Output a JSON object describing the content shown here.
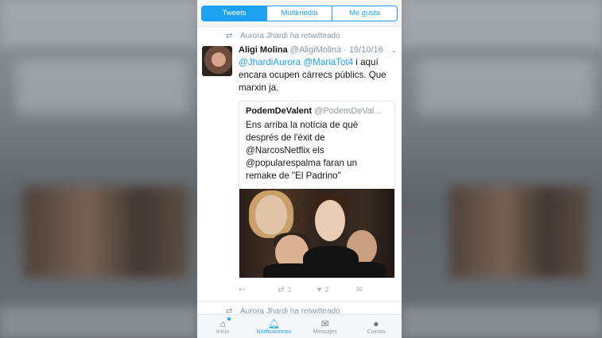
{
  "tabs": [
    "Tweets",
    "Multimedia",
    "Me gusta"
  ],
  "active_tab": 0,
  "retweet_line_1": "Aurora Jhardi ha retwitteado",
  "tweet": {
    "name": "Aligi Molina",
    "handle": "@AligiMolina",
    "date": "· 19/10/16",
    "mention_1": "@JhardiAurora",
    "mention_2": "@MariaTot4",
    "text_after": " i aquí encara ocupen càrrecs públics. Que marxin ja.",
    "quote": {
      "name": "PodemDeValent",
      "handle": "@PodemDeVal...",
      "text": "Ens arriba la notícia de què després de l'èxit de @NarcosNetflix els @popularespalma faran un remake de \"El Padrino\""
    },
    "retweet_count": "1",
    "like_count": "2"
  },
  "retweet_line_2": "Aurora Jhardi ha retwitteado",
  "bottom_nav": {
    "inicio": "Inicio",
    "notificaciones": "Notificaciones",
    "mensajes": "Mensajes",
    "cuenta": "Cuenta"
  },
  "colors": {
    "accent": "#1da1f2",
    "muted": "#8899a6"
  }
}
